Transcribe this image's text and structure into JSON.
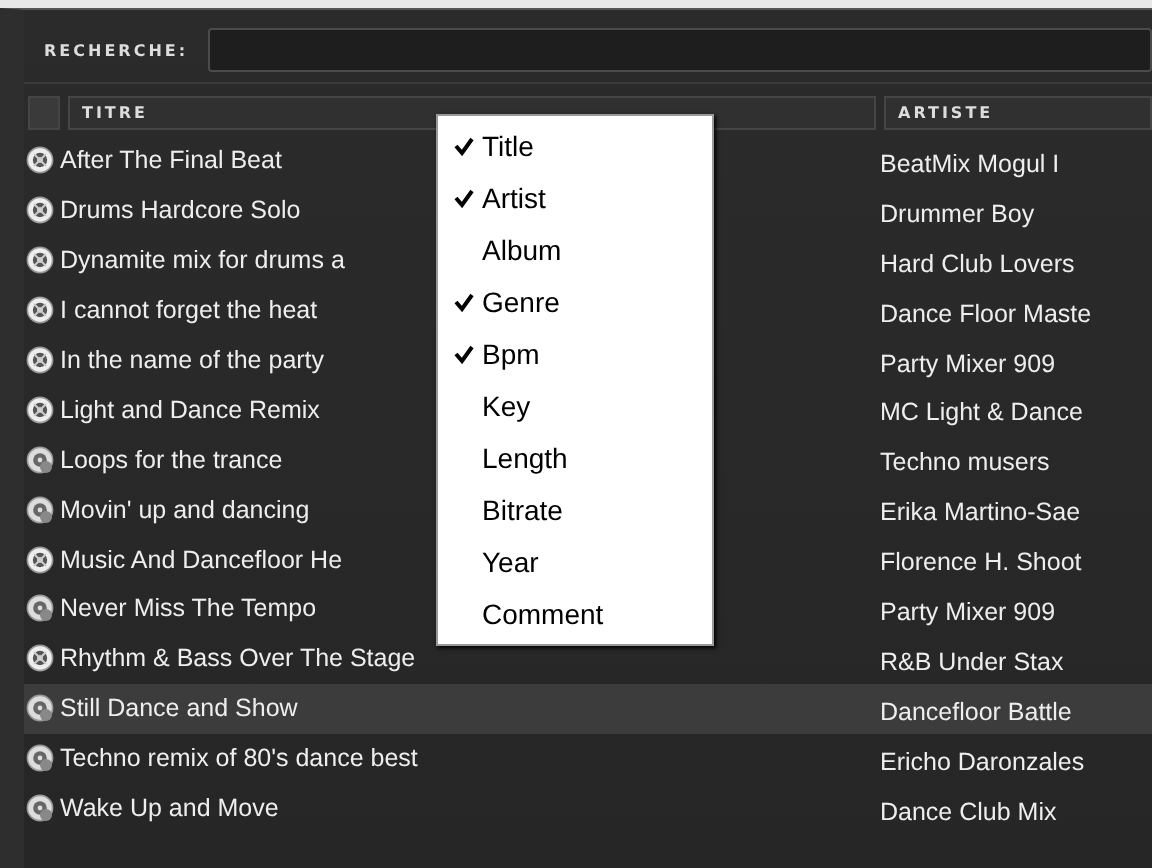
{
  "search": {
    "label": "RECHERCHE:"
  },
  "table": {
    "columns": [
      "TITRE",
      "ARTISTE"
    ],
    "rows": [
      {
        "title": "After The Final Beat",
        "artist": "BeatMix Mogul I",
        "kind": "disc",
        "selected": false
      },
      {
        "title": "Drums Hardcore Solo",
        "artist": "Drummer Boy",
        "kind": "disc",
        "selected": false
      },
      {
        "title": "Dynamite mix for drums a",
        "artist": "Hard Club Lovers",
        "kind": "disc",
        "selected": false
      },
      {
        "title": "I cannot forget the heat",
        "artist": "Dance Floor Maste",
        "kind": "disc",
        "selected": false
      },
      {
        "title": "In the name of the party",
        "artist": "Party Mixer 909",
        "kind": "disc",
        "selected": false
      },
      {
        "title": "Light and Dance Remix",
        "artist": "MC Light & Dance",
        "kind": "disc",
        "selected": false
      },
      {
        "title": "Loops for the trance",
        "artist": "Techno musers",
        "kind": "globe",
        "selected": false
      },
      {
        "title": "Movin' up and dancing",
        "artist": "Erika Martino-Sae",
        "kind": "globe",
        "selected": false
      },
      {
        "title": "Music And Dancefloor He",
        "artist": "Florence H. Shoot",
        "kind": "disc",
        "selected": false
      },
      {
        "title": "Never Miss The Tempo",
        "artist": "Party Mixer 909",
        "kind": "globe",
        "selected": false
      },
      {
        "title": "Rhythm & Bass Over The Stage",
        "artist": "R&B Under Stax",
        "kind": "disc",
        "selected": false
      },
      {
        "title": "Still Dance and Show",
        "artist": "Dancefloor Battle",
        "kind": "globe",
        "selected": true
      },
      {
        "title": "Techno remix of 80's dance best",
        "artist": "Ericho Daronzales",
        "kind": "globe",
        "selected": false
      },
      {
        "title": "Wake Up and Move",
        "artist": "Dance Club Mix",
        "kind": "globe",
        "selected": false
      }
    ]
  },
  "context_menu": {
    "items": [
      {
        "label": "Title",
        "checked": true
      },
      {
        "label": "Artist",
        "checked": true
      },
      {
        "label": "Album",
        "checked": false
      },
      {
        "label": "Genre",
        "checked": true
      },
      {
        "label": "Bpm",
        "checked": true
      },
      {
        "label": "Key",
        "checked": false
      },
      {
        "label": "Length",
        "checked": false
      },
      {
        "label": "Bitrate",
        "checked": false
      },
      {
        "label": "Year",
        "checked": false
      },
      {
        "label": "Comment",
        "checked": false
      }
    ]
  }
}
